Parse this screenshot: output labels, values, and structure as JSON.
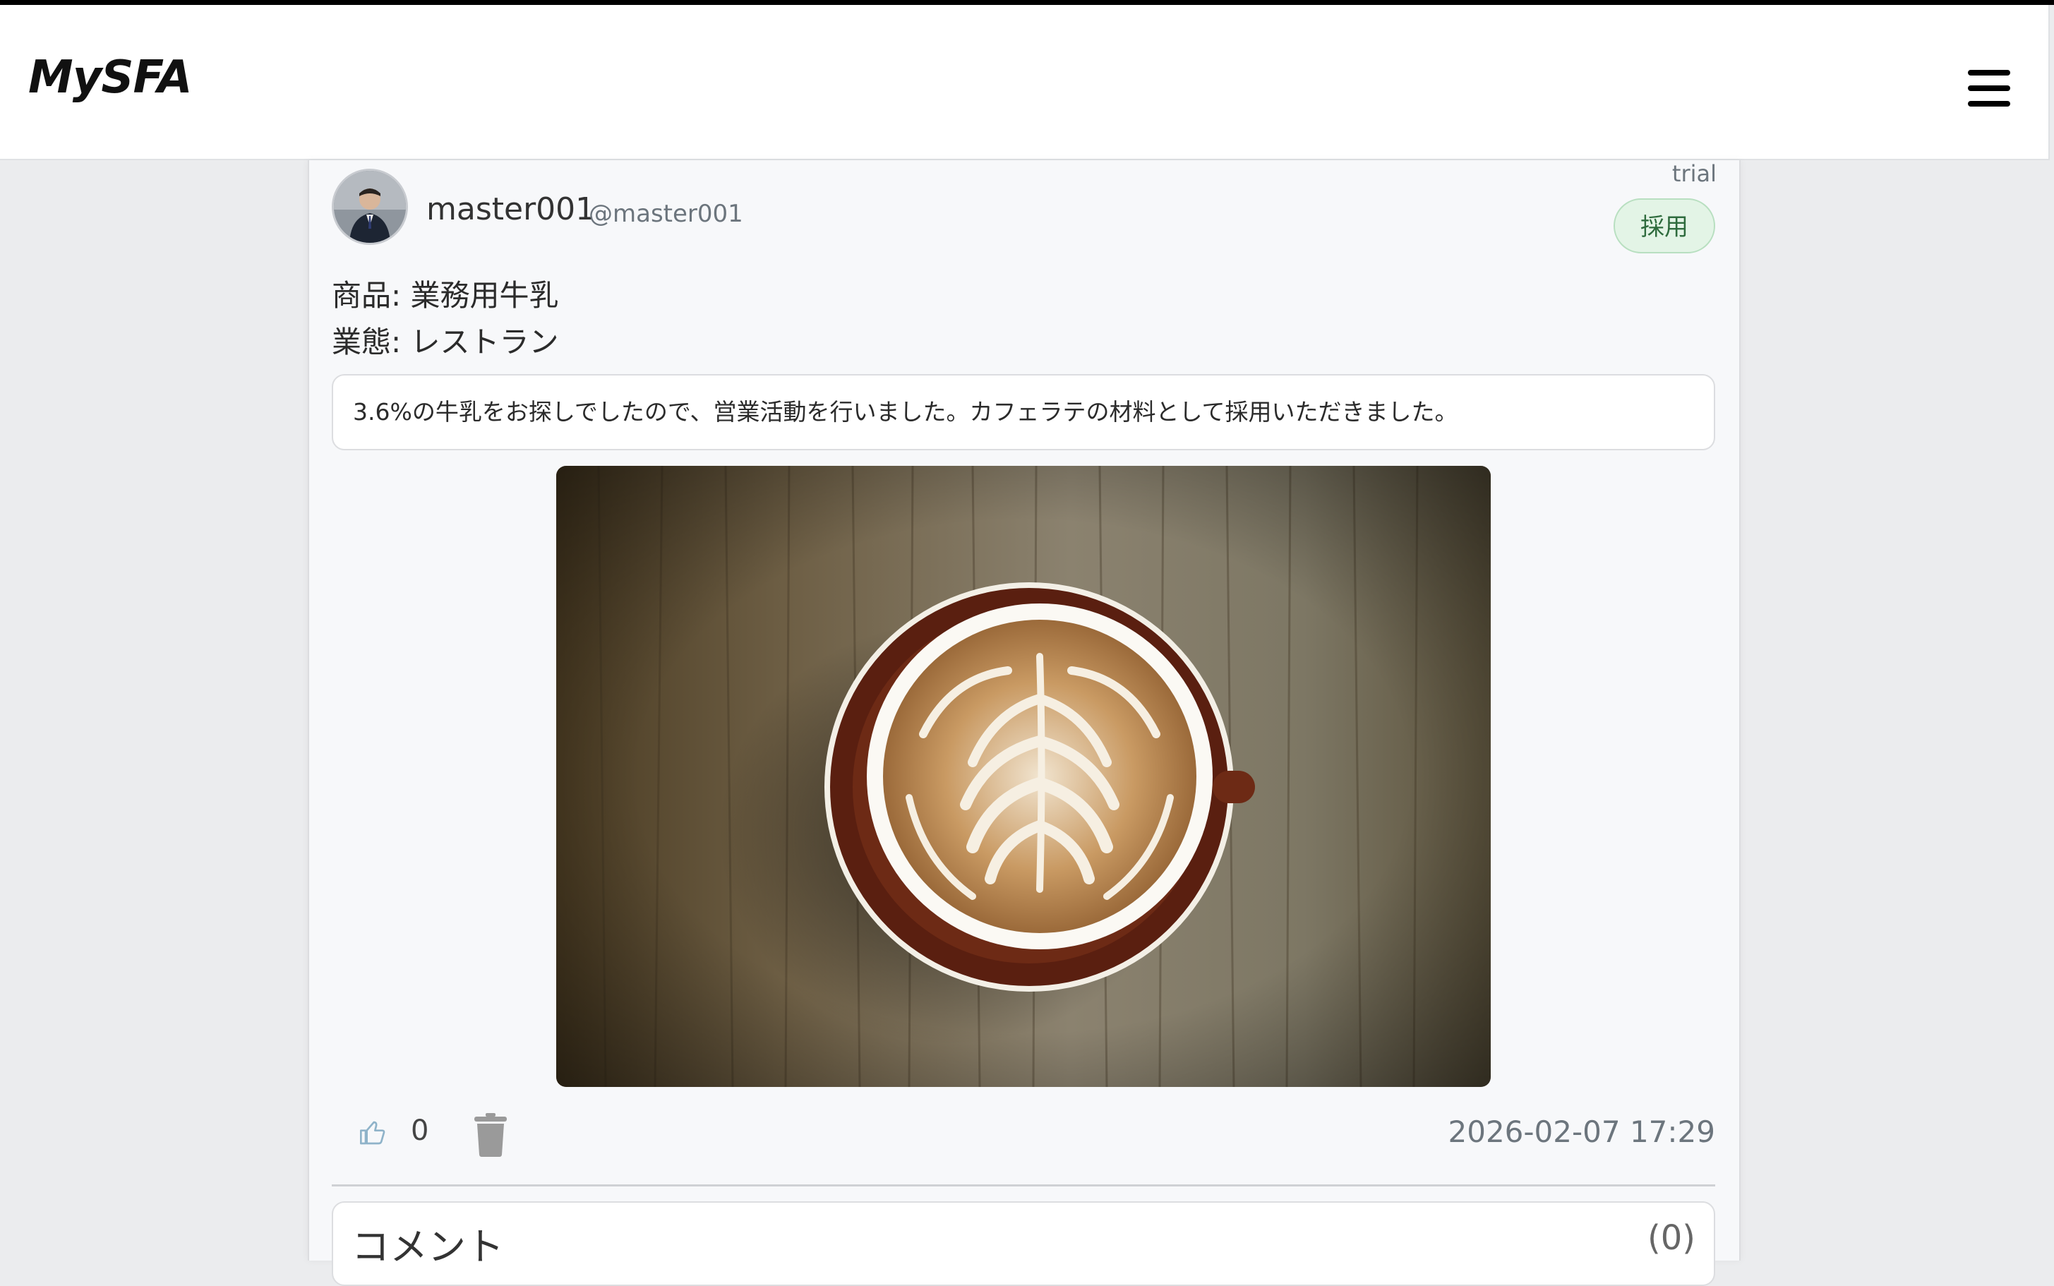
{
  "app": {
    "brand": "MySFA"
  },
  "post": {
    "plan_label": "trial",
    "status_badge": "採用",
    "user": {
      "display_name": "master001",
      "handle": "@master001"
    },
    "product_line": "商品: 業務用牛乳",
    "business_line": "業態: レストラン",
    "message": "3.6%の牛乳をお探しでしたので、営業活動を行いました。カフェラテの材料として採用いただきました。",
    "photo_icon": "latte-photo",
    "like_count": "0",
    "timestamp": "2026-02-07 17:29"
  },
  "comments": {
    "title": "コメント",
    "count": "(0)"
  },
  "colors": {
    "badge_bg": "#e3f4e6",
    "badge_text": "#2e6b3d",
    "page_bg": "#ebecee",
    "card_bg": "#f7f8fa"
  },
  "icons": {
    "menu": "hamburger-menu-icon",
    "like": "thumbs-up-icon",
    "delete": "trash-icon"
  }
}
